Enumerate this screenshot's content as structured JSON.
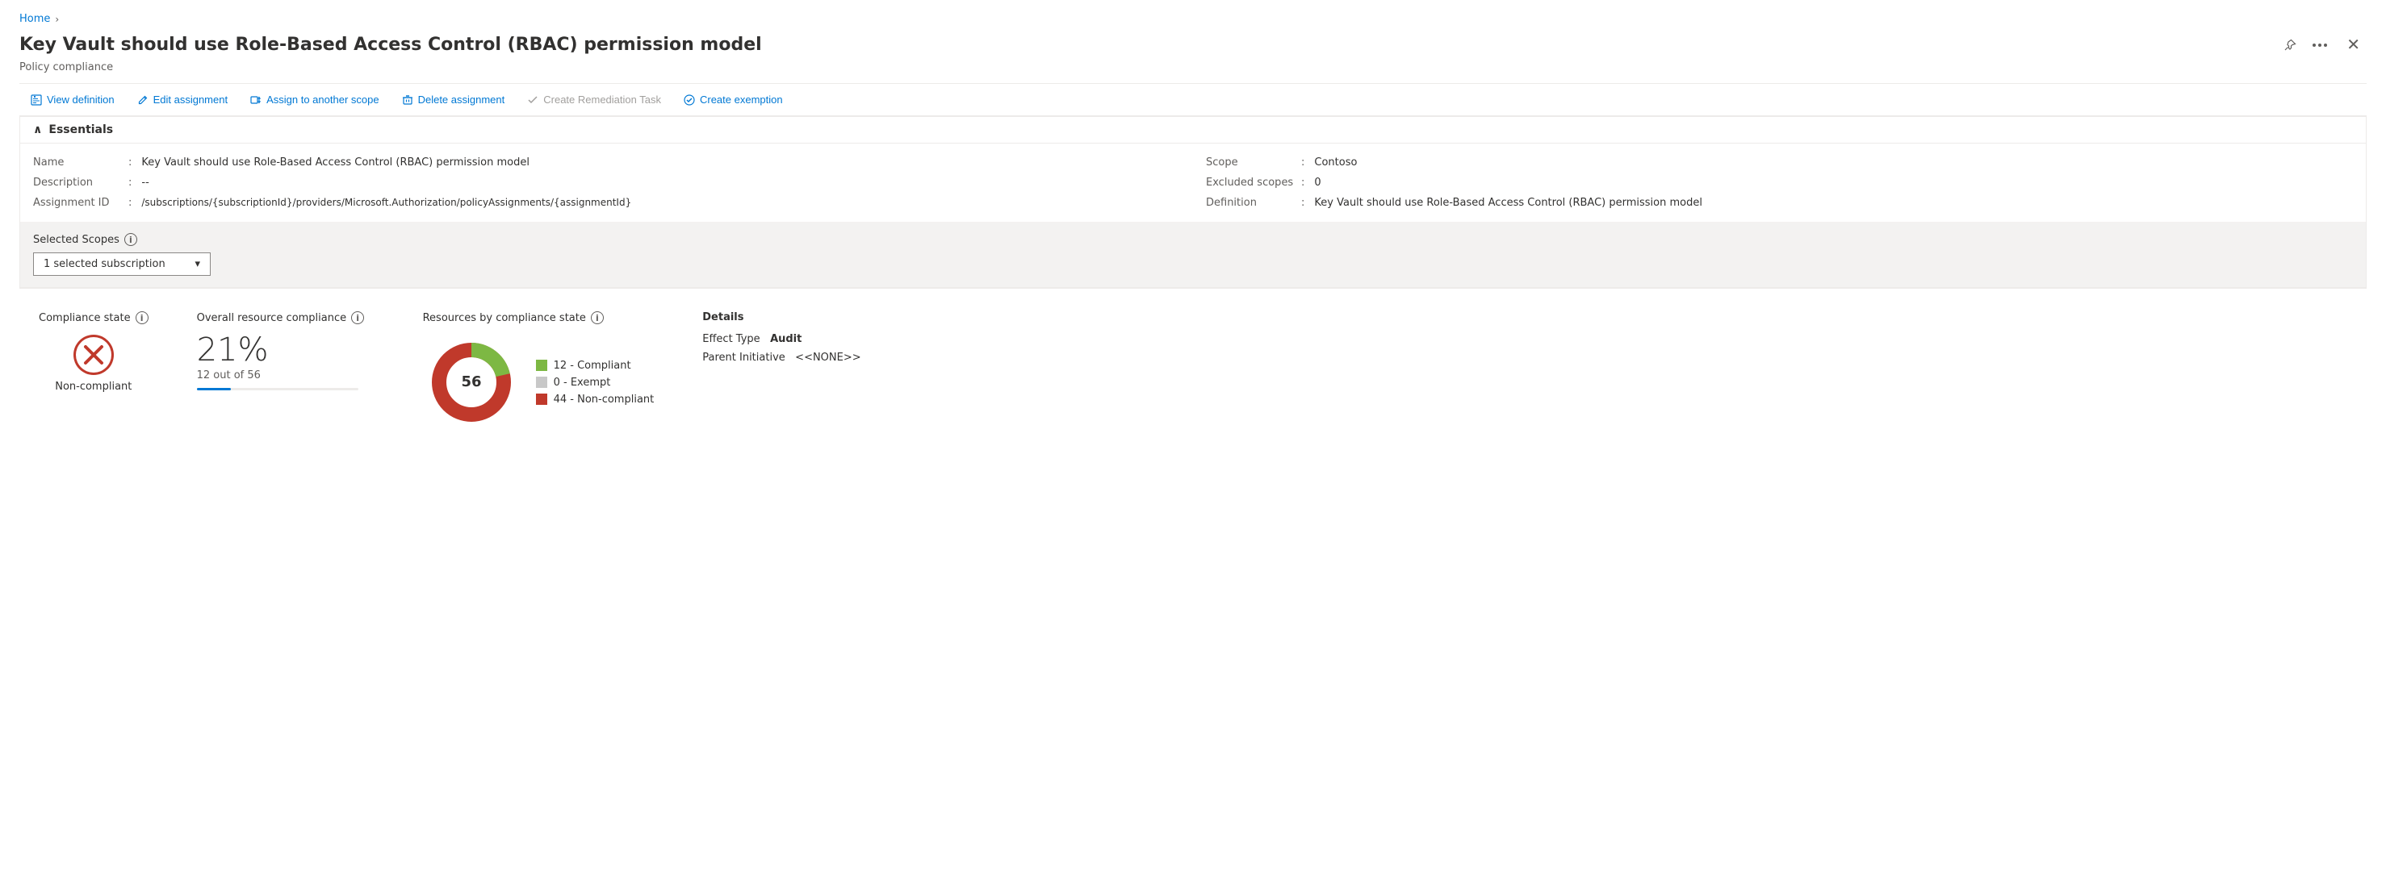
{
  "breadcrumb": {
    "home_label": "Home",
    "separator": "›"
  },
  "header": {
    "title": "Key Vault should use Role-Based Access Control (RBAC) permission model",
    "subtitle": "Policy compliance",
    "pin_icon": "📌",
    "more_icon": "···",
    "close_icon": "✕"
  },
  "toolbar": {
    "view_definition": "View definition",
    "edit_assignment": "Edit assignment",
    "assign_to_scope": "Assign to another scope",
    "delete_assignment": "Delete assignment",
    "create_remediation": "Create Remediation Task",
    "create_exemption": "Create exemption"
  },
  "essentials": {
    "section_label": "Essentials",
    "name_label": "Name",
    "name_value": "Key Vault should use Role-Based Access Control (RBAC) permission model",
    "description_label": "Description",
    "description_value": "--",
    "assignment_id_label": "Assignment ID",
    "assignment_id_value": "/subscriptions/{subscriptionId}/providers/Microsoft.Authorization/policyAssignments/{assignmentId}",
    "scope_label": "Scope",
    "scope_value": "Contoso",
    "excluded_scopes_label": "Excluded scopes",
    "excluded_scopes_value": "0",
    "definition_label": "Definition",
    "definition_value": "Key Vault should use Role-Based Access Control (RBAC) permission model"
  },
  "scopes": {
    "label": "Selected Scopes",
    "dropdown_value": "1 selected subscription",
    "info_icon": "i"
  },
  "compliance_state": {
    "label": "Compliance state",
    "value": "Non-compliant",
    "info_icon": "i"
  },
  "overall_resource": {
    "label": "Overall resource compliance",
    "percentage": "21%",
    "fraction": "12 out of 56",
    "progress_pct": 21,
    "info_icon": "i"
  },
  "resources_by_state": {
    "label": "Resources by compliance state",
    "total": "56",
    "compliant_count": 12,
    "exempt_count": 0,
    "non_compliant_count": 44,
    "compliant_label": "12 - Compliant",
    "exempt_label": "0 - Exempt",
    "non_compliant_label": "44 - Non-compliant",
    "compliant_color": "#7db843",
    "exempt_color": "#c8c8c8",
    "non_compliant_color": "#c0392b",
    "info_icon": "i"
  },
  "details": {
    "label": "Details",
    "effect_type_label": "Effect Type",
    "effect_type_value": "Audit",
    "parent_initiative_label": "Parent Initiative",
    "parent_initiative_value": "<<NONE>>"
  }
}
